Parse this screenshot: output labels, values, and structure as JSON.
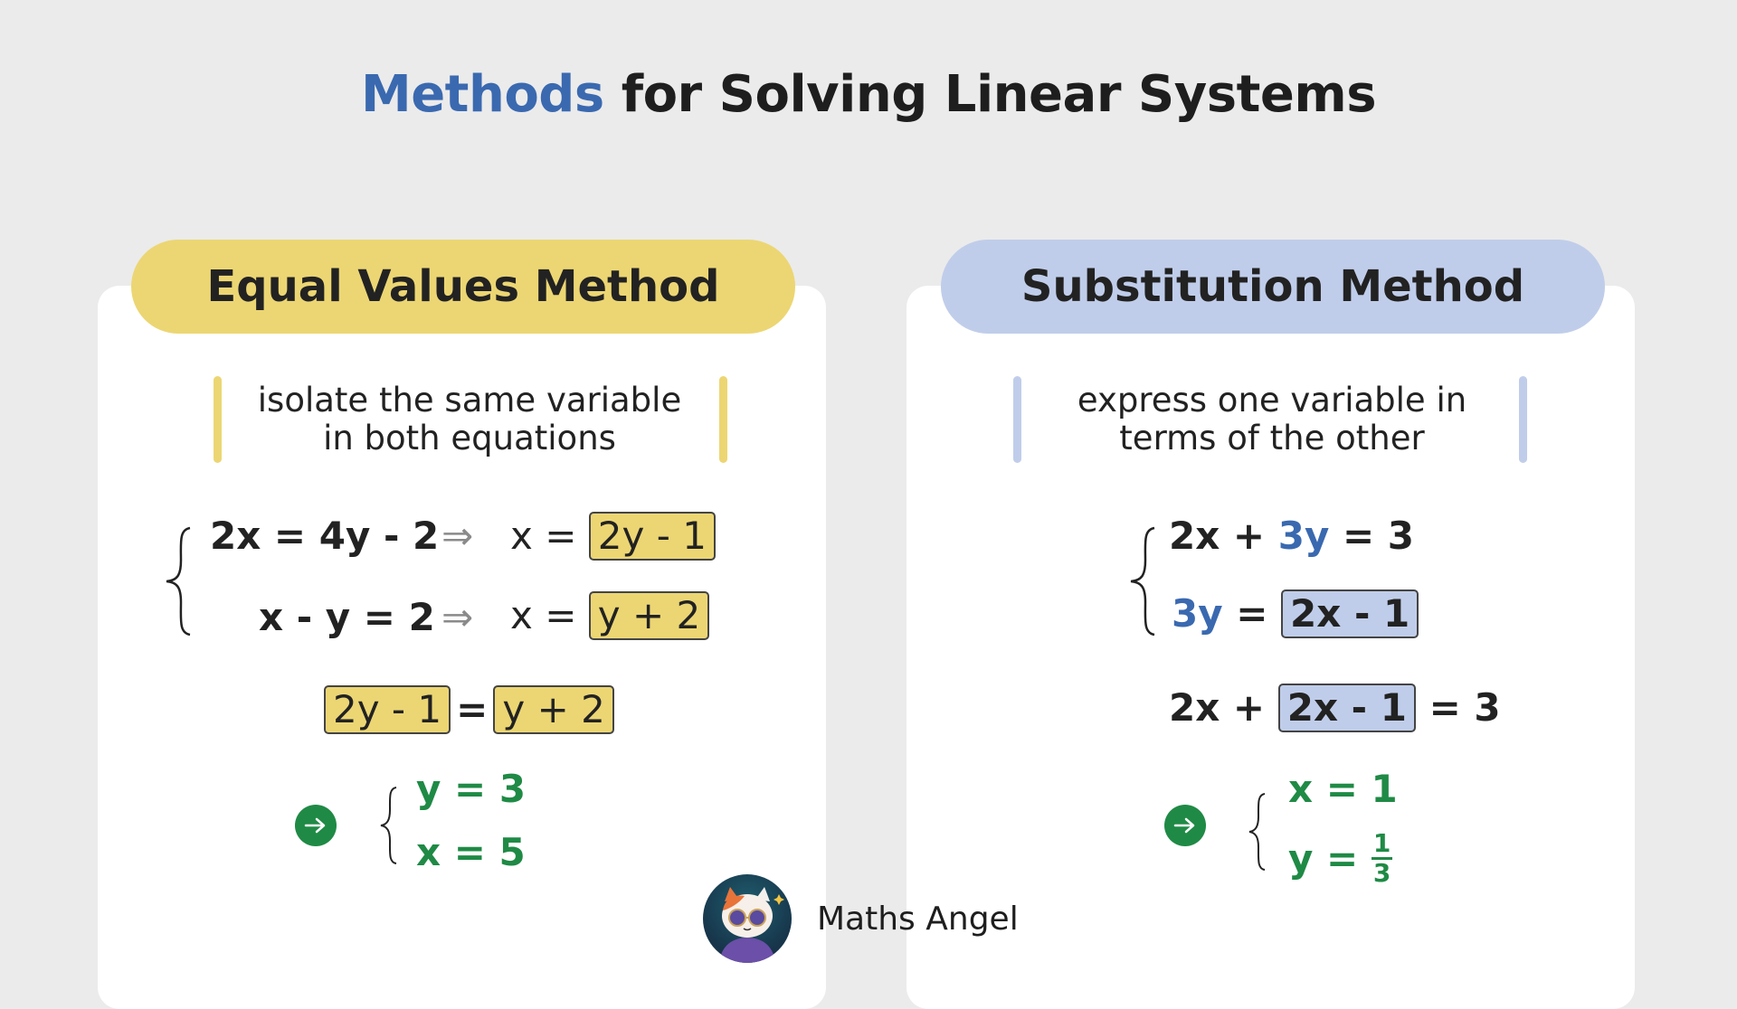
{
  "title": {
    "accent": "Methods",
    "rest": " for Solving Linear Systems"
  },
  "colors": {
    "accent_blue": "#3a69b0",
    "yellow": "#ecd673",
    "light_blue": "#c0cdea",
    "green": "#1f8a45",
    "background": "#ebebeb"
  },
  "left": {
    "heading": "Equal Values Method",
    "description_line1": "isolate the same variable",
    "description_line2": "in both equations",
    "system": [
      {
        "equation": "2x = 4y - 2",
        "arrow": "⇒",
        "lhs": "x =",
        "isolated": "2y - 1"
      },
      {
        "equation": "x - y = 2",
        "arrow": "⇒",
        "lhs": "x =",
        "isolated": "y + 2"
      }
    ],
    "equate": {
      "left": "2y - 1",
      "op": "=",
      "right": "y + 2"
    },
    "solution": {
      "icon": "arrow-right-icon",
      "line1": "y = 3",
      "line2": "x = 5"
    }
  },
  "right": {
    "heading": "Substitution Method",
    "description_line1": "express one variable in",
    "description_line2": "terms of the other",
    "system": {
      "eq1": {
        "pre": "2x + ",
        "highlight": "3y",
        "post": " = 3"
      },
      "eq2": {
        "highlight": "3y",
        "op": " = ",
        "boxed": "2x - 1"
      }
    },
    "substituted": {
      "pre": "2x + ",
      "boxed": "2x - 1",
      "post": " = 3"
    },
    "solution": {
      "icon": "arrow-right-icon",
      "line1": "x = 1",
      "line2_prefix": "y = ",
      "numerator": "1",
      "denominator": "3"
    }
  },
  "brand": {
    "name": "Maths Angel",
    "logo": "cat-mascot-logo"
  }
}
